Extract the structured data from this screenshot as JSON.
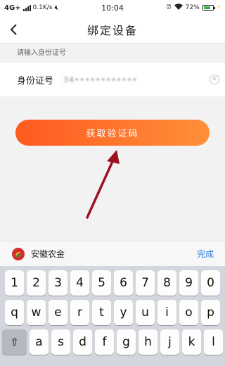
{
  "status_bar": {
    "network": "4G+",
    "speed": "0.1K/s",
    "time": "10:04",
    "battery_percent": "72%",
    "battery_level": 0.72
  },
  "nav": {
    "title": "绑定设备",
    "back_icon": "chevron-left-icon"
  },
  "form": {
    "hint": "请输入身份证号",
    "id_label": "身份证号",
    "id_value": "34••••••••••••",
    "clear_icon": "clear-icon"
  },
  "button": {
    "label": "获取验证码",
    "gradient_start": "#ff5a1f",
    "gradient_end": "#ff8f3a"
  },
  "annotation": {
    "arrow_color": "#9b1220"
  },
  "keyboard_toolbar": {
    "bank_name": "安徽农金",
    "done_label": "完成",
    "done_color": "#2f7de1"
  },
  "keyboard": {
    "row1": [
      "1",
      "2",
      "3",
      "4",
      "5",
      "6",
      "7",
      "8",
      "9",
      "0"
    ],
    "row2": [
      "q",
      "w",
      "e",
      "r",
      "t",
      "y",
      "u",
      "i",
      "o",
      "p"
    ],
    "row3": [
      "a",
      "s",
      "d",
      "f",
      "g",
      "h",
      "j",
      "k",
      "l"
    ]
  }
}
